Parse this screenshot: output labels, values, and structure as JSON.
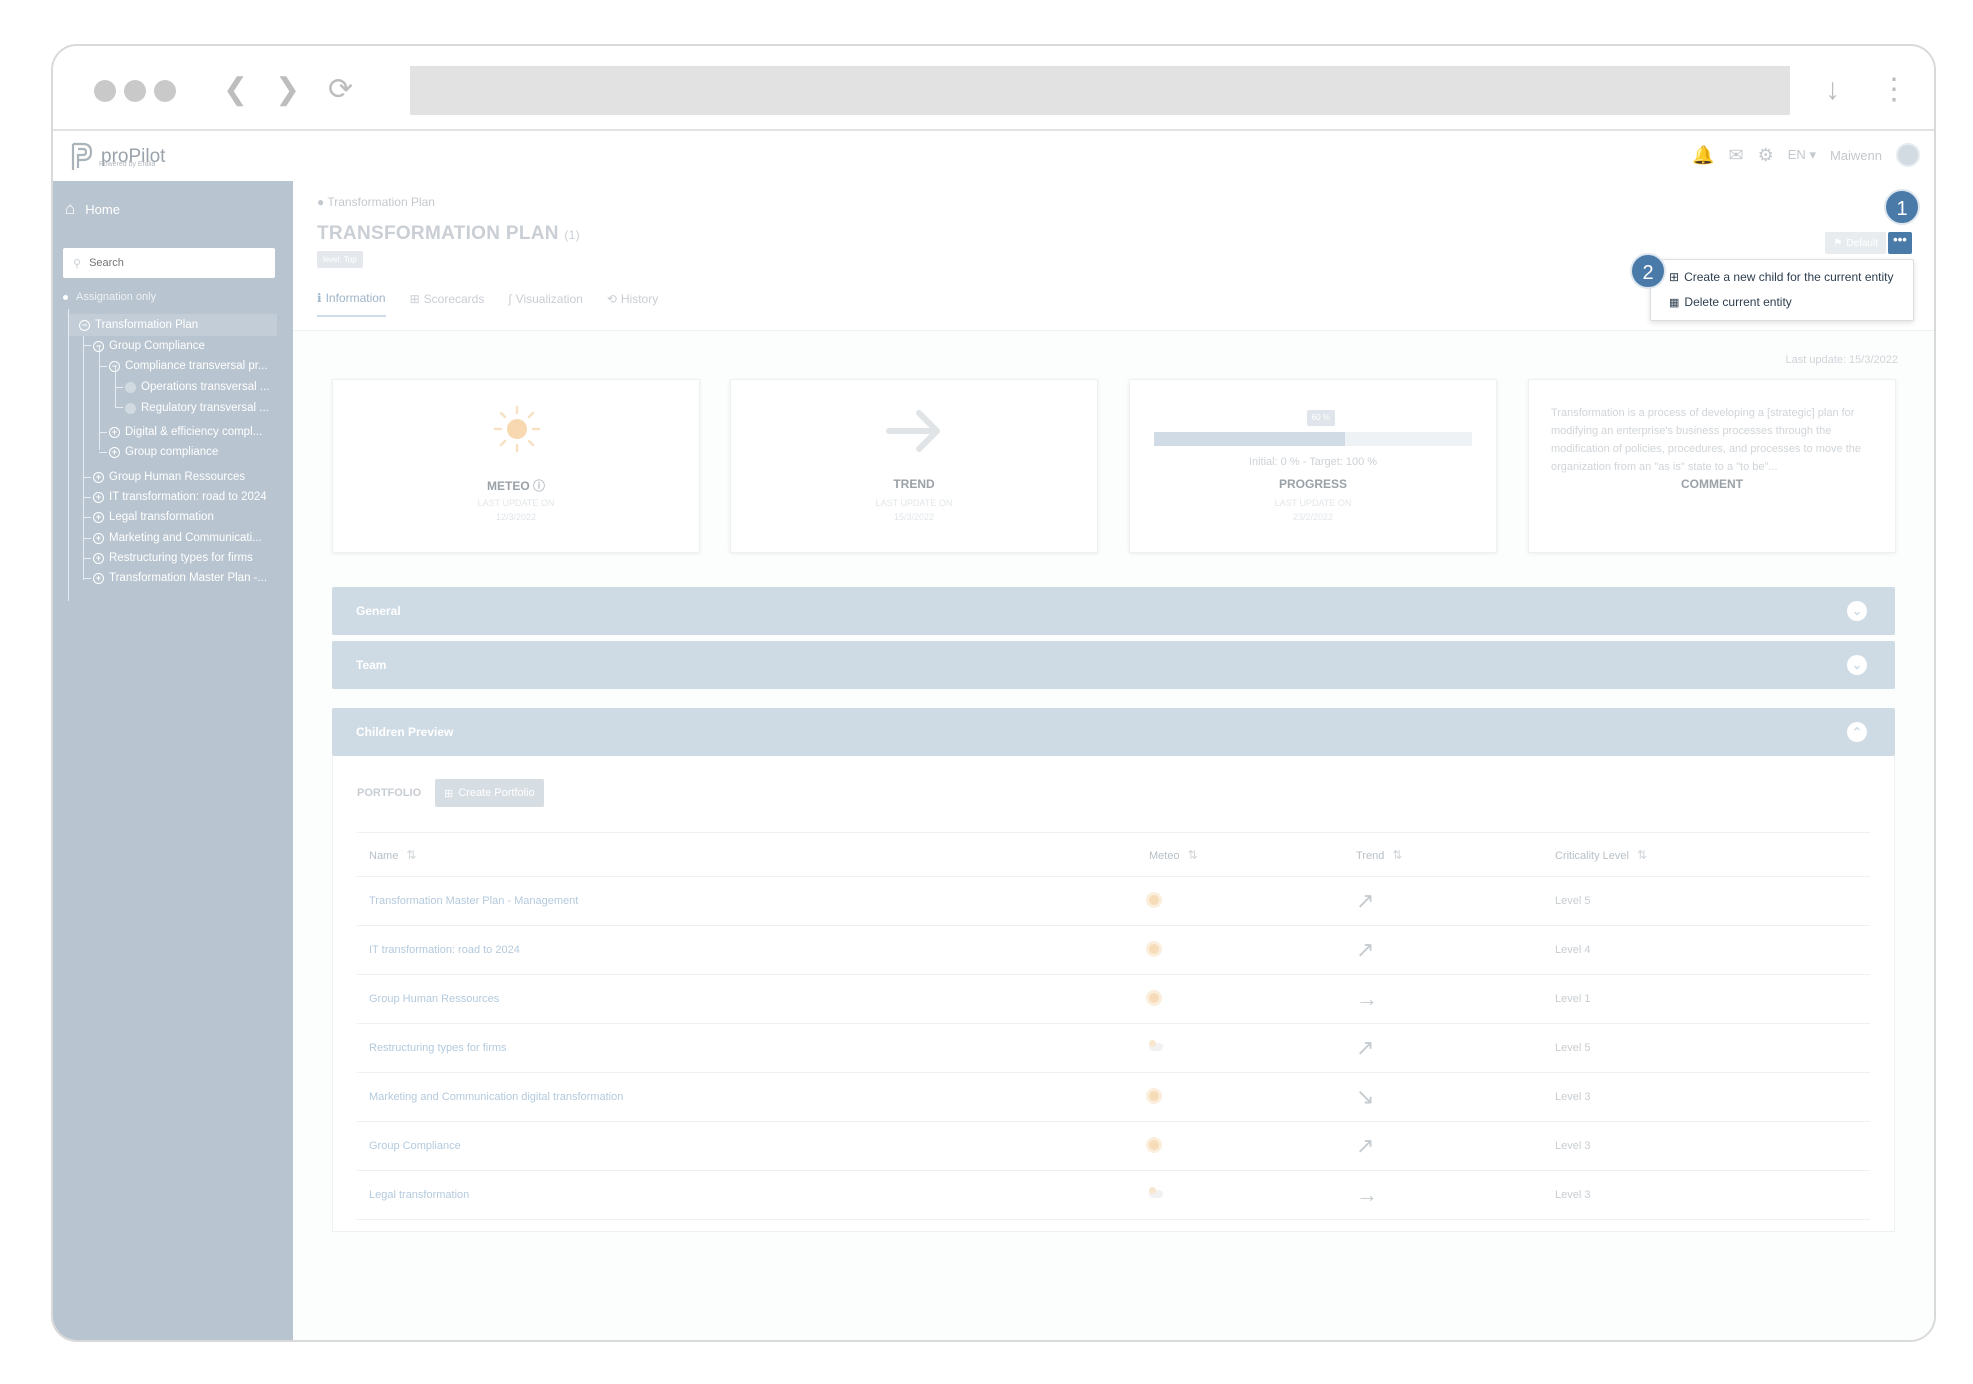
{
  "app": {
    "name": "proPilot",
    "powered_by": "Powered by Efalia",
    "language": "EN",
    "user": "Maiwenn"
  },
  "sidebar": {
    "home_label": "Home",
    "search_placeholder": "Search",
    "filter_label": "Assignation only",
    "tree": [
      "Transformation Plan",
      "Group Compliance",
      "Compliance transversal pr...",
      "Operations transversal ...",
      "Regulatory transversal ...",
      "Digital & efficiency compl...",
      "Group compliance",
      "Group Human Ressources",
      "IT transformation: road to 2024",
      "Legal transformation",
      "Marketing and Communicati...",
      "Restructuring types for firms",
      "Transformation Master Plan -..."
    ]
  },
  "header": {
    "breadcrumb": "Transformation Plan",
    "title": "TRANSFORMATION PLAN",
    "count": "(1)",
    "level_badge": "level: Top",
    "default_label": "Default",
    "more_label": "•••"
  },
  "menu": {
    "create_child": "Create a new child for the current entity",
    "delete": "Delete current entity"
  },
  "steps": [
    "1",
    "2"
  ],
  "tabs": [
    "Information",
    "Scorecards",
    "Visualization",
    "History"
  ],
  "last_update": "Last update: 15/3/2022",
  "cards": {
    "meteo": {
      "title": "METEO",
      "sub": "LAST UPDATE ON",
      "date": "12/3/2022"
    },
    "trend": {
      "title": "TREND",
      "sub": "LAST UPDATE ON",
      "date": "15/3/2022"
    },
    "progress": {
      "title": "PROGRESS",
      "sub": "LAST UPDATE ON",
      "date": "23/2/2022",
      "value_pct": 60,
      "tip": "60 %",
      "text": "Initial: 0 % - Target: 100 %"
    },
    "comment": {
      "title": "COMMENT",
      "text": "Transformation is a process of developing a [strategic] plan for modifying an enterprise's business processes through the modification of policies, procedures, and processes to move the organization from an \"as is\" state to a \"to be\"..."
    }
  },
  "accordions": {
    "general": "General",
    "team": "Team",
    "children": "Children Preview"
  },
  "portfolio": {
    "label": "PORTFOLIO",
    "create_label": "Create Portfolio",
    "columns": [
      "Name",
      "Meteo",
      "Trend",
      "Criticality Level"
    ],
    "rows": [
      {
        "name": "Transformation Master Plan - Management",
        "meteo": "sun",
        "trend": "up",
        "level": "Level 5"
      },
      {
        "name": "IT transformation: road to 2024",
        "meteo": "sun",
        "trend": "up",
        "level": "Level 4"
      },
      {
        "name": "Group Human Ressources",
        "meteo": "sun",
        "trend": "flat",
        "level": "Level 1"
      },
      {
        "name": "Restructuring types for firms",
        "meteo": "cloud",
        "trend": "up",
        "level": "Level 5"
      },
      {
        "name": "Marketing and Communication digital transformation",
        "meteo": "sun",
        "trend": "down",
        "level": "Level 3"
      },
      {
        "name": "Group Compliance",
        "meteo": "sun",
        "trend": "up",
        "level": "Level 3"
      },
      {
        "name": "Legal transformation",
        "meteo": "cloud",
        "trend": "flat",
        "level": "Level 3"
      }
    ]
  },
  "colors": {
    "accent": "#4a7aa8",
    "sidebar": "#b8c4cf",
    "accordion": "#cfdbe4"
  }
}
